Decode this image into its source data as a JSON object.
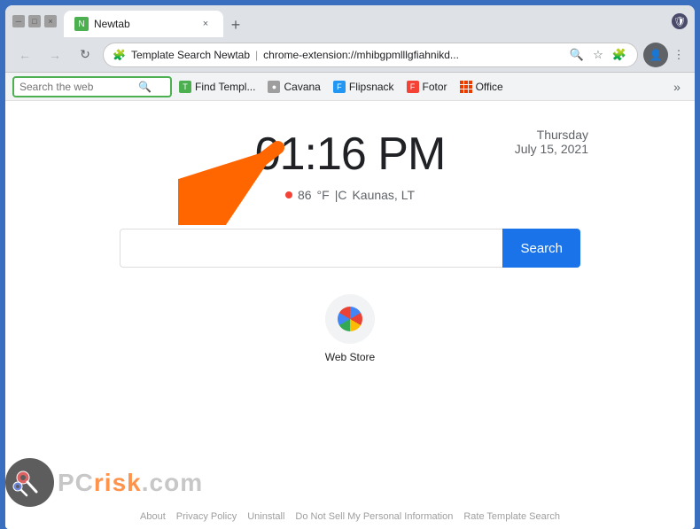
{
  "browser": {
    "title": "Newtab",
    "tab_label": "Newtab",
    "url_prefix": "Template Search Newtab",
    "url_extension": "chrome-extension://mhibgpmlllgfiahnikd...",
    "url_separator": "|"
  },
  "bookmarks_bar": {
    "search_placeholder": "Search the web",
    "find_templates_label": "Find Templ...",
    "cavana_label": "Cavana",
    "flipsnack_label": "Flipsnack",
    "fotor_label": "Fotor",
    "office_label": "Office"
  },
  "clock": {
    "time": "01:16 PM",
    "day": "Thursday",
    "date": "July 15, 2021"
  },
  "weather": {
    "temp": "86",
    "unit_f": "°F",
    "separator": "|C",
    "location": "Kaunas, LT"
  },
  "search": {
    "input_placeholder": "",
    "button_label": "Search"
  },
  "shortcuts": [
    {
      "label": "Web Store",
      "icon": "rainbow"
    }
  ],
  "footer": {
    "links": [
      "About",
      "Privacy Policy",
      "Uninstall",
      "Do Not Sell My Personal Information",
      "Rate Template Search"
    ]
  }
}
